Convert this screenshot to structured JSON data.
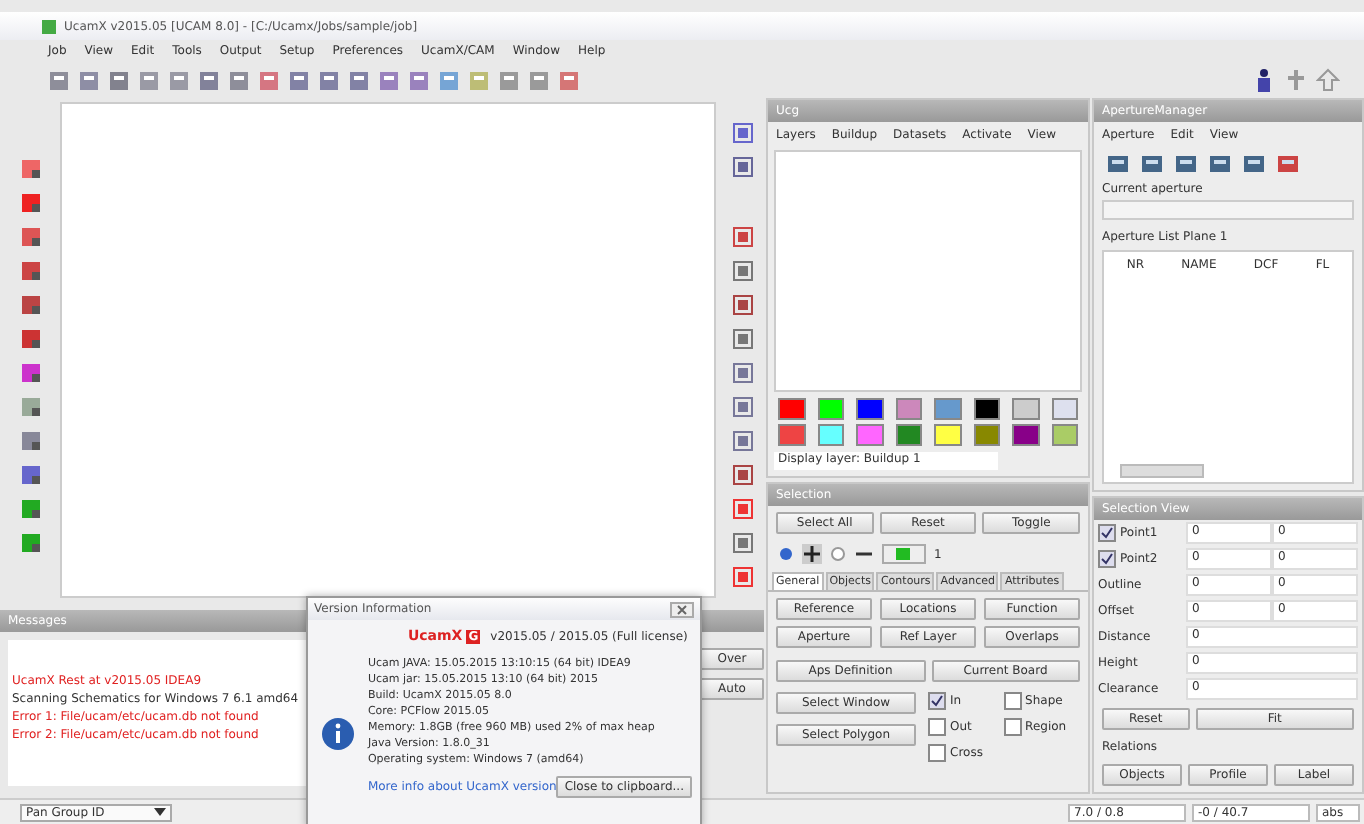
{
  "window": {
    "title": "UcamX v2015.05 [UCAM 8.0] - [C:/Ucamx/Jobs/sample/job]"
  },
  "menu": [
    "Job",
    "View",
    "Edit",
    "Tools",
    "Output",
    "Setup",
    "Preferences",
    "UcamX/CAM",
    "Window",
    "Help"
  ],
  "layers_panel": {
    "title": "Ucg",
    "menu": [
      "Layers",
      "Buildup",
      "Datasets",
      "Activate",
      "View"
    ],
    "swatches": [
      {
        "color": "#ff0000"
      },
      {
        "color": "#00ff00"
      },
      {
        "color": "#0000ff"
      },
      {
        "color": "#cc88bb"
      },
      {
        "color": "#6699cc"
      },
      {
        "color": "#000000"
      },
      {
        "color": "#cccccc"
      },
      {
        "color": "#dde0ee"
      },
      {
        "color": "#ee4444"
      },
      {
        "color": "#66ffff"
      },
      {
        "color": "#ff66ff"
      },
      {
        "color": "#228822"
      },
      {
        "color": "#ffff44"
      },
      {
        "color": "#888800"
      },
      {
        "color": "#880088"
      },
      {
        "color": "#aacc66"
      }
    ],
    "display_layer": "Display layer: Buildup 1"
  },
  "aperture_manager": {
    "title": "ApertureManager",
    "menu": [
      "Aperture",
      "Edit",
      "View"
    ],
    "current_aperture_label": "Current aperture",
    "list_label": "Aperture List Plane 1",
    "columns": [
      "NR",
      "NAME",
      "DCF",
      "FL"
    ]
  },
  "selection": {
    "title": "Selection",
    "top_buttons": [
      "Select All",
      "Reset",
      "Toggle"
    ],
    "level_value": "1",
    "tabs": [
      {
        "label": "General",
        "selected": true
      },
      {
        "label": "Objects",
        "selected": false
      },
      {
        "label": "Contours",
        "selected": false
      },
      {
        "label": "Advanced",
        "selected": false
      },
      {
        "label": "Attributes",
        "selected": false
      }
    ],
    "grid_buttons": [
      "Reference",
      "Locations",
      "Function",
      "Aperture",
      "Ref Layer",
      "Overlaps"
    ],
    "wide_buttons": [
      "Aps Definition",
      "Current Board"
    ],
    "side_buttons": [
      "Select Window",
      "Select Polygon"
    ],
    "options": [
      {
        "label": "In",
        "checked": true
      },
      {
        "label": "Shape",
        "checked": false
      },
      {
        "label": "Out",
        "checked": false
      },
      {
        "label": "Region",
        "checked": false
      },
      {
        "label": "Cross",
        "checked": false
      }
    ]
  },
  "selection_view": {
    "title": "Selection View",
    "rows": [
      {
        "kind": "check",
        "label": "Point1",
        "checked": true,
        "value": "0",
        "value2": "0"
      },
      {
        "kind": "check",
        "label": "Point2",
        "checked": true,
        "value": "0",
        "value2": "0"
      },
      {
        "kind": "pair",
        "label": "Outline",
        "value": "0",
        "value2": "0"
      },
      {
        "kind": "pair",
        "label": "Offset",
        "value": "0",
        "value2": "0"
      },
      {
        "kind": "single",
        "label": "Distance",
        "value": "0"
      },
      {
        "kind": "single",
        "label": "Height",
        "value": "0"
      },
      {
        "kind": "single",
        "label": "Clearance",
        "value": "0"
      }
    ],
    "buttons": [
      "Reset",
      "Fit"
    ],
    "relations_label": "Relations",
    "relation_buttons": [
      "Objects",
      "Profile",
      "Label"
    ]
  },
  "messages": {
    "title": "Messages",
    "lines": [
      {
        "text": "UcamX Rest at v2015.05 IDEA9",
        "error": true
      },
      {
        "text": "Scanning Schematics for Windows 7 6.1 amd64",
        "error": false
      },
      {
        "text": "Error 1: File/ucam/etc/ucam.db not found",
        "error": true
      },
      {
        "text": "Error 2: File/ucam/etc/ucam.db not found",
        "error": true
      }
    ],
    "side_buttons": [
      "Over",
      "Auto"
    ]
  },
  "version_dialog": {
    "title": "Version Information",
    "product": "UcamX",
    "product_badge": "G",
    "version": "v2015.05 / 2015.05 (Full license)",
    "lines": [
      "Ucam JAVA: 15.05.2015 13:10:15 (64 bit) IDEA9",
      "Ucam jar: 15.05.2015 13:10 (64 bit) 2015",
      "Build: UcamX 2015.05 8.0",
      "Core: PCFlow 2015.05",
      "Memory: 1.8GB (free 960 MB) used 2% of max heap",
      "Java Version: 1.8.0_31",
      "Operating system: Windows 7 (amd64)"
    ],
    "link": "More info about UcamX version",
    "button": "Close to clipboard..."
  },
  "status_bar": {
    "dropdown": "Pan Group ID",
    "x": "7.0 / 0.8",
    "y": "-0 / 40.7",
    "unit": "abs"
  }
}
